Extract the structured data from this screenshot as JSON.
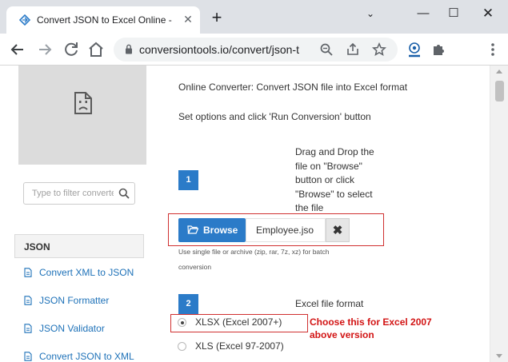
{
  "browser": {
    "tab_title": "Convert JSON to Excel Online - JSON",
    "url": "conversiontools.io/convert/json-t...",
    "new_tab_symbol": "+",
    "icons": [
      "converter-favicon",
      "close-icon",
      "plus-icon",
      "chevron-down-icon",
      "minimize-icon",
      "maximize-icon",
      "close-icon",
      "back-arrow-icon",
      "forward-arrow-icon",
      "reload-icon",
      "home-icon",
      "lock-icon",
      "zoom-icon",
      "share-icon",
      "star-icon",
      "extension-icon",
      "puzzle-icon",
      "more-vert-icon"
    ]
  },
  "sidebar": {
    "filter_placeholder": "Type to filter converters",
    "section_title": "JSON",
    "items": [
      {
        "label": "Convert XML to JSON"
      },
      {
        "label": "JSON Formatter"
      },
      {
        "label": "JSON Validator"
      },
      {
        "label": "Convert JSON to XML"
      }
    ]
  },
  "main": {
    "intro": "Online Converter: Convert JSON file into Excel format",
    "subintro": "Set options and click 'Run Conversion' button",
    "step1": {
      "number": "1",
      "instruction": "Drag and Drop the file on \"Browse\" button or click \"Browse\" to select the file",
      "browse_label": "Browse",
      "file_name": "Employee.jso",
      "clear_symbol": "✖",
      "hint": "Use single file or archive (zip, rar, 7z, xz) for batch conversion"
    },
    "step2": {
      "number": "2",
      "label": "Excel file format",
      "options": [
        {
          "label": "XLSX (Excel 2007+)",
          "selected": true
        },
        {
          "label": "XLS (Excel 97-2007)",
          "selected": false
        }
      ]
    },
    "callout": "Choose this for Excel 2007 above version"
  },
  "colors": {
    "accent": "#2b7bc8",
    "link": "#1d71b8",
    "annotation": "#d21414"
  }
}
